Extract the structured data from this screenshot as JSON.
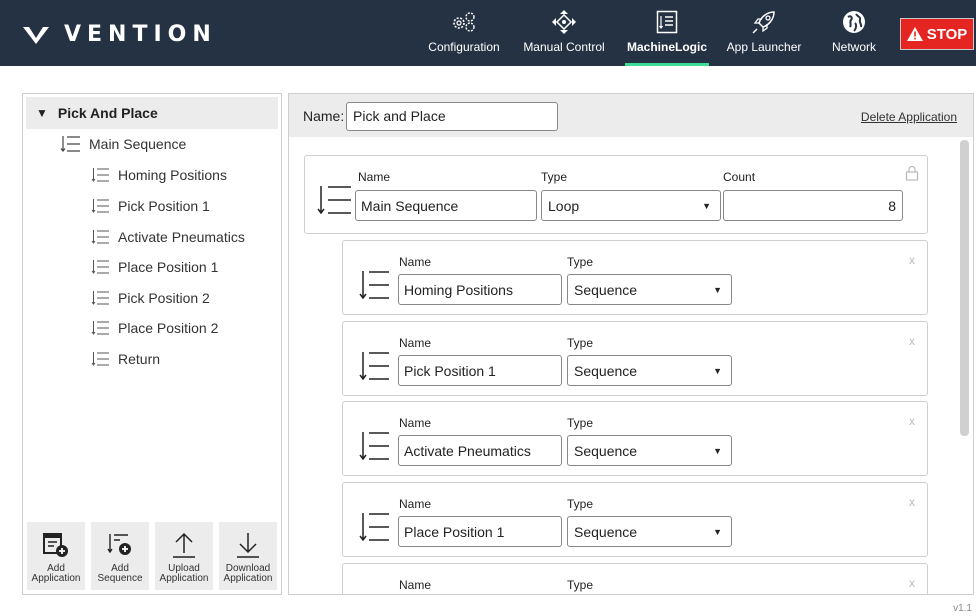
{
  "brand": {
    "name": "VENTION",
    "icon": "vention-logo-icon"
  },
  "nav": [
    {
      "label": "Configuration",
      "icon": "gears-icon"
    },
    {
      "label": "Manual Control",
      "icon": "crosshair-icon"
    },
    {
      "label": "MachineLogic",
      "icon": "logic-list-icon",
      "active": true
    },
    {
      "label": "App Launcher",
      "icon": "rocket-icon"
    },
    {
      "label": "Network",
      "icon": "globe-icon"
    }
  ],
  "stop_label": "STOP",
  "colors": {
    "topbar": "#253244",
    "accent": "#3ddc97",
    "stop": "#e52521"
  },
  "sidebar": {
    "root": "Pick And Place",
    "main_sequence": "Main Sequence",
    "items": [
      "Homing Positions",
      "Pick Position 1",
      "Activate Pneumatics",
      "Place Position 1",
      "Pick Position 2",
      "Place Position 2",
      "Return"
    ],
    "actions": [
      {
        "label1": "Add",
        "label2": "Application",
        "icon": "add-application-icon"
      },
      {
        "label1": "Add",
        "label2": "Sequence",
        "icon": "add-sequence-icon"
      },
      {
        "label1": "Upload",
        "label2": "Application",
        "icon": "upload-icon"
      },
      {
        "label1": "Download",
        "label2": "Application",
        "icon": "download-icon"
      }
    ]
  },
  "main": {
    "name_label": "Name:",
    "name_value": "Pick and Place",
    "delete_label": "Delete Application",
    "top_card": {
      "name_label": "Name",
      "type_label": "Type",
      "count_label": "Count",
      "name": "Main Sequence",
      "type": "Loop",
      "count": "8"
    },
    "cards": [
      {
        "name_label": "Name",
        "type_label": "Type",
        "name": "Homing Positions",
        "type": "Sequence"
      },
      {
        "name_label": "Name",
        "type_label": "Type",
        "name": "Pick Position 1",
        "type": "Sequence"
      },
      {
        "name_label": "Name",
        "type_label": "Type",
        "name": "Activate Pneumatics",
        "type": "Sequence"
      },
      {
        "name_label": "Name",
        "type_label": "Type",
        "name": "Place Position 1",
        "type": "Sequence"
      },
      {
        "name_label": "Name",
        "type_label": "Type",
        "name": "",
        "type": ""
      }
    ],
    "close_glyph": "x"
  },
  "version": "v1.1"
}
